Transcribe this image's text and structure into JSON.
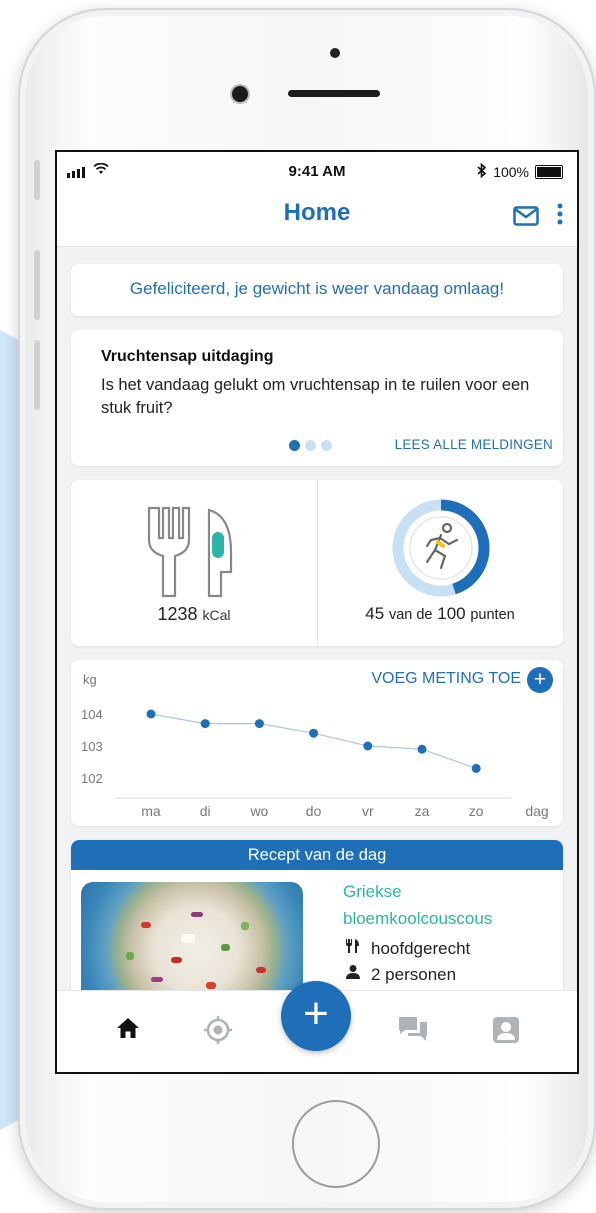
{
  "statusbar": {
    "time": "9:41 AM",
    "battery": "100%"
  },
  "header": {
    "title": "Home"
  },
  "notification": {
    "message": "Gefeliciteerd, je gewicht is weer vandaag omlaag!"
  },
  "challenge": {
    "title": "Vruchtensap uitdaging",
    "text": "Is het vandaag gelukt om vruchtensap in te ruilen voor een stuk fruit?",
    "pager": {
      "pages": 3,
      "active": 1
    },
    "link": "LEES ALLE MELDINGEN"
  },
  "stats": {
    "kcal_value": "1238",
    "kcal_unit": "kCal",
    "points_value": "45",
    "points_of": "van de",
    "points_total": "100",
    "points_unit": "punten",
    "progress_fraction": 0.45
  },
  "weight": {
    "unit_label": "kg",
    "add_label": "VOEG METING TOE",
    "add_icon": "+",
    "x_axis_label": "dag"
  },
  "chart_data": {
    "type": "line",
    "categories": [
      "ma",
      "di",
      "wo",
      "do",
      "vr",
      "za",
      "zo"
    ],
    "values": [
      104.0,
      103.7,
      103.7,
      103.4,
      103.0,
      102.9,
      102.3
    ],
    "yticks": [
      "104",
      "103",
      "102"
    ],
    "ylabel": "kg",
    "xlabel": "dag",
    "ylim": [
      102,
      104
    ],
    "grid": false
  },
  "recipe": {
    "header": "Recept van de dag",
    "name": "Griekse bloemkoolcouscous",
    "course": "hoofdgerecht",
    "servings": "2 personen"
  },
  "bottom_nav": {
    "add_label": "+"
  },
  "colors": {
    "brand": "#1f6fb8",
    "accent": "#2bb5a6",
    "ring_track": "#c8e0f4"
  }
}
